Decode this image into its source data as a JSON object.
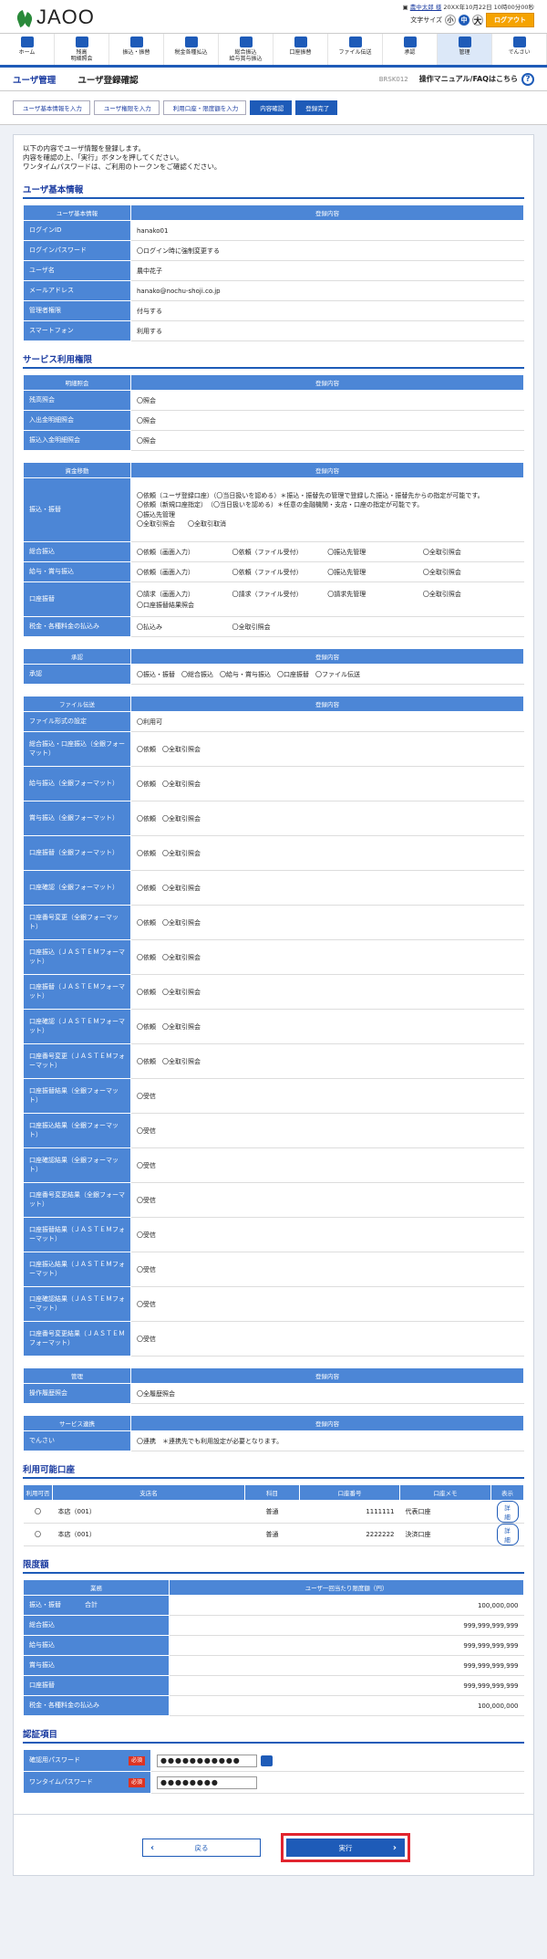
{
  "header": {
    "logo": "JAOO",
    "user_name": "農中太郎 様",
    "login_time": "20XX年10月22日 10時00分00秒",
    "font_size_label": "文字サイズ",
    "font_small": "小",
    "font_mid": "中",
    "font_large": "大",
    "logout": "ログアウト"
  },
  "nav": [
    {
      "label": "ホーム"
    },
    {
      "label": "残高\n明細照会"
    },
    {
      "label": "振込・振替"
    },
    {
      "label": "税金各種払込"
    },
    {
      "label": "総合振込\n給与賞与振込"
    },
    {
      "label": "口座振替"
    },
    {
      "label": "ファイル伝送"
    },
    {
      "label": "承認"
    },
    {
      "label": "管理"
    },
    {
      "label": "でんさい"
    }
  ],
  "page": {
    "section": "ユーザ管理",
    "title": "ユーザ登録確認",
    "code": "BRSK012",
    "faq": "操作マニュアル/FAQはこちら"
  },
  "steps": [
    "ユーザ基本情報を入力",
    "ユーザ権限を入力",
    "利用口座・限度額を入力",
    "内容確認",
    "登録完了"
  ],
  "intro": [
    "以下の内容でユーザ情報を登録します。",
    "内容を確認の上、「実行」ボタンを押してください。",
    "ワンタイムパスワードは、ご利用のトークンをご確認ください。"
  ],
  "basic": {
    "title": "ユーザ基本情報",
    "h1": "ユーザ基本情報",
    "h2": "登録内容",
    "rows": [
      {
        "k": "ログインID",
        "v": "hanako01"
      },
      {
        "k": "ログインパスワード",
        "v": "〇ログイン時に強制変更する"
      },
      {
        "k": "ユーザ名",
        "v": "農中花子"
      },
      {
        "k": "メールアドレス",
        "v": "hanako@nochu-shoji.co.jp"
      },
      {
        "k": "管理者権限",
        "v": "付与する"
      },
      {
        "k": "スマートフォン",
        "v": "利用する"
      }
    ]
  },
  "perm": {
    "title": "サービス利用権限",
    "h2": "登録内容",
    "g1": {
      "h": "明細照会",
      "rows": [
        {
          "k": "残高照会",
          "v": "〇照会"
        },
        {
          "k": "入出金明細照会",
          "v": "〇照会"
        },
        {
          "k": "振込入金明細照会",
          "v": "〇照会"
        }
      ]
    },
    "g2": {
      "h": "資金移動",
      "furikomi_k": "振込・振替",
      "furikomi": [
        "〇依頼（ユーザ登録口座）（〇当日扱いを認める）＊振込・振替先の管理で登録した振込・振替先からの指定が可能です。",
        "〇依頼（新規口座指定）　（〇当日扱いを認める）＊任意の金融機関・支店・口座の指定が可能です。",
        "〇振込先管理",
        "〇全取引照会　　〇全取引取消"
      ],
      "sogo_k": "総合振込",
      "sogo": [
        "〇依頼（画面入力）",
        "〇依頼（ファイル受付）",
        "〇振込先管理",
        "〇全取引照会"
      ],
      "kyuyo_k": "給与・賞与振込",
      "kyuyo": [
        "〇依頼（画面入力）",
        "〇依頼（ファイル受付）",
        "〇振込先管理",
        "〇全取引照会"
      ],
      "koza_k": "口座振替",
      "koza": [
        "〇請求（画面入力）",
        "〇請求（ファイル受付）",
        "〇請求先管理",
        "〇全取引照会",
        "〇口座振替結果照会"
      ],
      "zei_k": "税金・各種料金の払込み",
      "zei": [
        "〇払込み",
        "〇全取引照会"
      ]
    },
    "g3": {
      "h": "承認",
      "k": "承認",
      "v": "〇振込・振替　〇総合振込　〇給与・賞与振込　〇口座振替　〇ファイル伝送"
    },
    "g4": {
      "h": "ファイル伝送",
      "rows": [
        {
          "k": "ファイル形式の設定",
          "v": "〇利用可"
        },
        {
          "k": "総合振込・口座振込（全銀フォーマット）",
          "v": "〇依頼　〇全取引照会"
        },
        {
          "k": "給与振込（全銀フォーマット）",
          "v": "〇依頼　〇全取引照会"
        },
        {
          "k": "賞与振込（全銀フォーマット）",
          "v": "〇依頼　〇全取引照会"
        },
        {
          "k": "口座振替（全銀フォーマット）",
          "v": "〇依頼　〇全取引照会"
        },
        {
          "k": "口座確認（全銀フォーマット）",
          "v": "〇依頼　〇全取引照会"
        },
        {
          "k": "口座番号変更（全銀フォーマット）",
          "v": "〇依頼　〇全取引照会"
        },
        {
          "k": "口座振込（ＪＡＳＴＥＭフォーマット）",
          "v": "〇依頼　〇全取引照会"
        },
        {
          "k": "口座振替（ＪＡＳＴＥＭフォーマット）",
          "v": "〇依頼　〇全取引照会"
        },
        {
          "k": "口座確認（ＪＡＳＴＥＭフォーマット）",
          "v": "〇依頼　〇全取引照会"
        },
        {
          "k": "口座番号変更（ＪＡＳＴＥＭフォーマット）",
          "v": "〇依頼　〇全取引照会"
        },
        {
          "k": "口座振替結果（全銀フォーマット）",
          "v": "〇受信"
        },
        {
          "k": "口座振込結果（全銀フォーマット）",
          "v": "〇受信"
        },
        {
          "k": "口座確認結果（全銀フォーマット）",
          "v": "〇受信"
        },
        {
          "k": "口座番号変更結果（全銀フォーマット）",
          "v": "〇受信"
        },
        {
          "k": "口座振替結果（ＪＡＳＴＥＭフォーマット）",
          "v": "〇受信"
        },
        {
          "k": "口座振込結果（ＪＡＳＴＥＭフォーマット）",
          "v": "〇受信"
        },
        {
          "k": "口座確認結果（ＪＡＳＴＥＭフォーマット）",
          "v": "〇受信"
        },
        {
          "k": "口座番号変更結果（ＪＡＳＴＥＭフォーマット）",
          "v": "〇受信"
        }
      ]
    },
    "g5": {
      "h": "管理",
      "k": "操作履歴照会",
      "v": "〇全履歴照会"
    },
    "g6": {
      "h": "サービス連携",
      "k": "でんさい",
      "v": "〇連携　＊連携先でも利用設定が必要となります。"
    }
  },
  "accounts": {
    "title": "利用可能口座",
    "headers": [
      "利用可否",
      "支店名",
      "科目",
      "口座番号",
      "口座メモ",
      "表示"
    ],
    "rows": [
      {
        "use": "〇",
        "branch": "本店（001）",
        "type": "普通",
        "no": "1111111",
        "memo": "代表口座",
        "btn": "詳細"
      },
      {
        "use": "〇",
        "branch": "本店（001）",
        "type": "普通",
        "no": "2222222",
        "memo": "決済口座",
        "btn": "詳細"
      }
    ]
  },
  "limits": {
    "title": "限度額",
    "h1": "業務",
    "h2": "ユーザ一回当たり限度額（円）",
    "rows": [
      {
        "k": "振込・振替",
        "k2": "合計",
        "v": "100,000,000"
      },
      {
        "k": "総合振込",
        "v": "999,999,999,999"
      },
      {
        "k": "給与振込",
        "v": "999,999,999,999"
      },
      {
        "k": "賞与振込",
        "v": "999,999,999,999"
      },
      {
        "k": "口座振替",
        "v": "999,999,999,999"
      },
      {
        "k": "税金・各種料金の払込み",
        "v": "100,000,000"
      }
    ]
  },
  "auth": {
    "title": "認証項目",
    "confirm_k": "確認用パスワード",
    "otp_k": "ワンタイムパスワード",
    "req": "必須",
    "pw": "●●●●●●●●●●●",
    "otp": "●●●●●●●●"
  },
  "buttons": {
    "back": "戻る",
    "exec": "実行"
  }
}
